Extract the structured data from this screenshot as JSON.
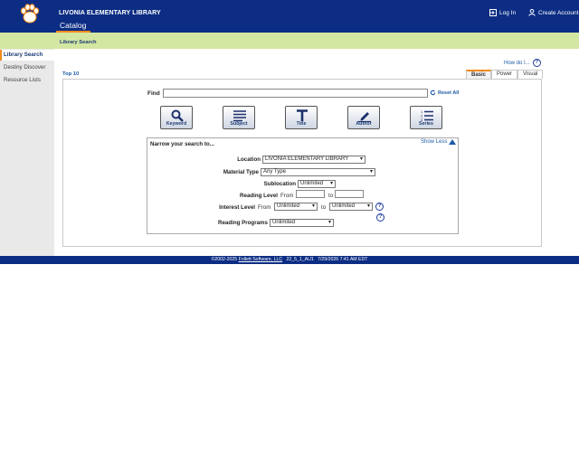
{
  "header": {
    "library_name": "LIVONIA ELEMENTARY LIBRARY",
    "catalog_tab": "Catalog",
    "login": "Log In",
    "create_account": "Create Account"
  },
  "breadcrumb": "Library Search",
  "sidebar": {
    "items": [
      {
        "label": "Library Search",
        "active": true
      },
      {
        "label": "Destiny Discover",
        "active": false
      },
      {
        "label": "Resource Lists",
        "active": false
      }
    ]
  },
  "main": {
    "how_do_i": "How do I...",
    "top10": "Top 10",
    "mode_tabs": [
      "Basic",
      "Power",
      "Visual"
    ],
    "active_mode": "Basic",
    "find_label": "Find",
    "find_value": "",
    "reset_all": "Reset All",
    "search_buttons": [
      {
        "label": "Keyword",
        "icon": "magnifier"
      },
      {
        "label": "Subject",
        "icon": "lines"
      },
      {
        "label": "Title",
        "icon": "letter-t"
      },
      {
        "label": "Author",
        "icon": "pen"
      },
      {
        "label": "Series",
        "icon": "numbered-list"
      }
    ],
    "narrow": {
      "title": "Narrow your search to...",
      "show_less": "Show Less",
      "location_label": "Location",
      "location_value": "LIVONIA ELEMENTARY LIBRARY",
      "material_type_label": "Material Type",
      "material_type_value": "Any Type",
      "sublocation_label": "Sublocation",
      "sublocation_value": "Unlimited",
      "reading_level_label": "Reading Level",
      "from_text": "From",
      "to_text": "to",
      "interest_level_label": "Interest Level",
      "interest_from_value": "Unlimited",
      "interest_to_value": "Unlimited",
      "reading_programs_label": "Reading Programs",
      "reading_programs_value": "Unlimited"
    }
  },
  "footer": {
    "copyright": "©2002-2025",
    "company": "Follett Software, LLC",
    "version": "22_5_1_AU1",
    "datetime": "7/29/2026 7:41 AM EDT"
  },
  "colors": {
    "header_bg": "#0c2d83",
    "subbar_bg": "#d3e6a2",
    "accent": "#f28b1c",
    "link": "#1c5aa8"
  }
}
